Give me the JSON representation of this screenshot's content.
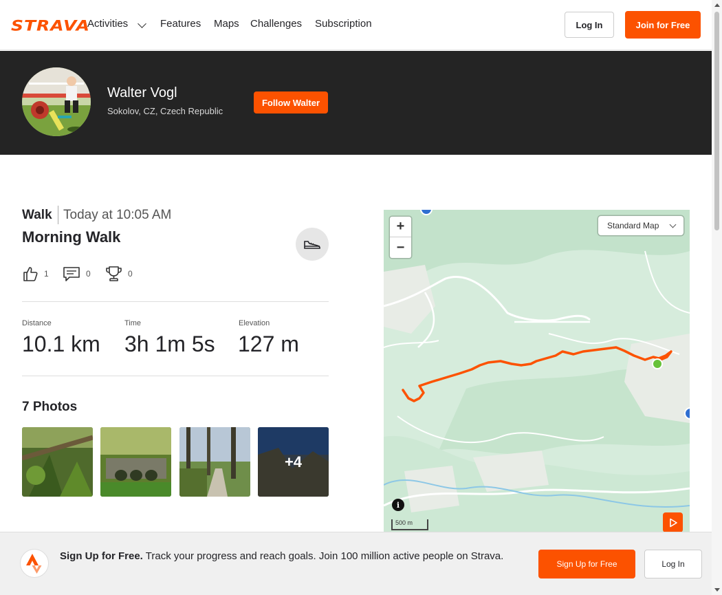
{
  "nav": {
    "logo": "STRAVA",
    "items": [
      "Activities",
      "Features",
      "Maps",
      "Challenges",
      "Subscription"
    ],
    "login_label": "Log In",
    "join_label": "Join for Free"
  },
  "athlete": {
    "name": "Walter Vogl",
    "location": "Sokolov, CZ, Czech Republic",
    "follow_label": "Follow Walter"
  },
  "activity": {
    "type": "Walk",
    "when": "Today at 10:05 AM",
    "title": "Morning Walk",
    "kudos": "1",
    "comments": "0",
    "achievements": "0",
    "stats": [
      {
        "label": "Distance",
        "value": "10.1 km"
      },
      {
        "label": "Time",
        "value": "3h 1m 5s"
      },
      {
        "label": "Elevation",
        "value": "127 m"
      }
    ]
  },
  "photos": {
    "title": "7 Photos",
    "more_label": "+4"
  },
  "map": {
    "zoom_in": "+",
    "zoom_out": "−",
    "map_type": "Standard Map",
    "info": "i",
    "scale": "500 m",
    "route_color": "#fc5200",
    "start_color": "#66c23a"
  },
  "banner": {
    "lead": "Sign Up for Free.",
    "text": "Track your progress and reach goals. Join 100 million active people on Strava.",
    "signup_label": "Sign Up for Free",
    "login_label": "Log In"
  },
  "colors": {
    "brand": "#fc5200",
    "header_bg": "#242424"
  }
}
